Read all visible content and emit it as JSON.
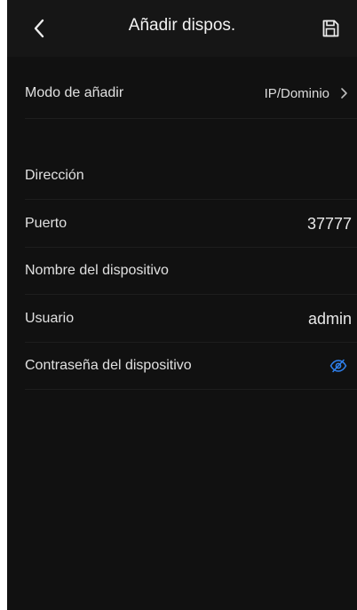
{
  "header": {
    "title": "Añadir dispos.",
    "back_icon": "chevron-left-icon",
    "save_icon": "save-icon"
  },
  "form": {
    "mode": {
      "label": "Modo de añadir",
      "value": "IP/Dominio"
    },
    "address": {
      "label": "Dirección",
      "value": ""
    },
    "port": {
      "label": "Puerto",
      "value": "37777"
    },
    "device_name": {
      "label": "Nombre del dispositivo",
      "value": ""
    },
    "user": {
      "label": "Usuario",
      "value": "admin"
    },
    "password": {
      "label": "Contraseña del dispositivo",
      "value": "",
      "toggle_icon": "eye-hidden-icon"
    }
  },
  "colors": {
    "background": "#111111",
    "header": "#161616",
    "accent": "#2f80ed"
  }
}
